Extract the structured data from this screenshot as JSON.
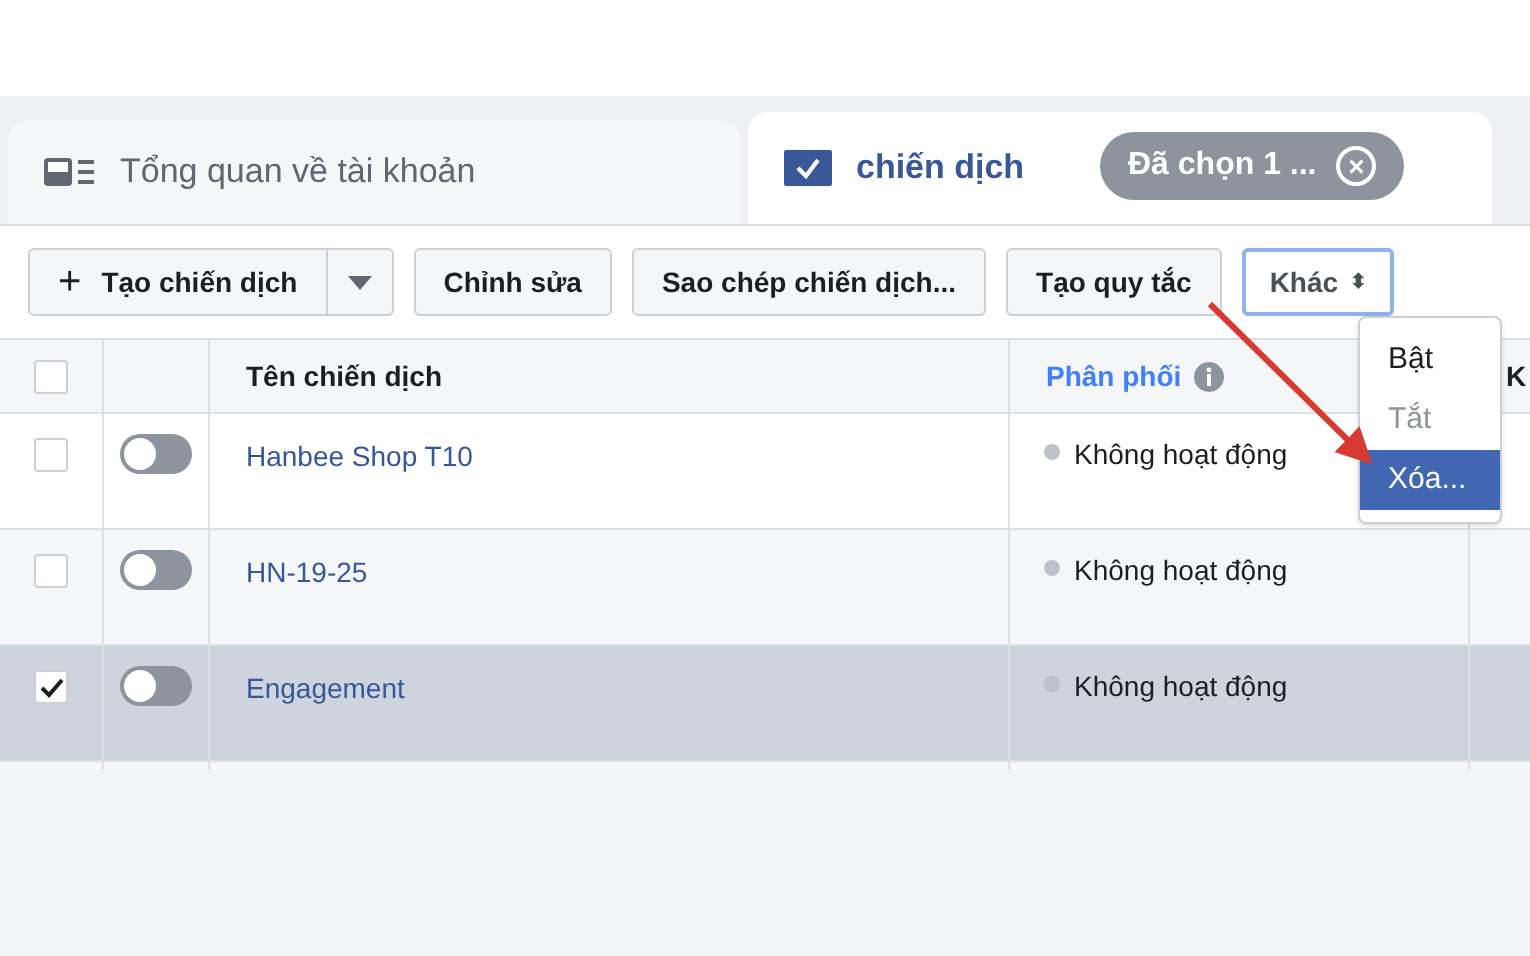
{
  "tabs": [
    {
      "label": "Tổng quan về tài khoản",
      "kind": "overview",
      "selected": false
    },
    {
      "label": "chiến dịch",
      "kind": "campaigns",
      "selected": true
    }
  ],
  "selection_chip": {
    "label": "Đã chọn 1 ...",
    "close": "×"
  },
  "toolbar": {
    "create": {
      "label": "Tạo chiến dịch",
      "icon": "+"
    },
    "buttons": [
      "Chỉnh sửa",
      "Sao chép chiến dịch...",
      "Tạo quy tắc"
    ],
    "more": {
      "label": "Khác",
      "caret": "⬍"
    }
  },
  "menu": [
    {
      "label": "Bật",
      "disabled": false,
      "selected": false
    },
    {
      "label": "Tắt",
      "disabled": true,
      "selected": false
    },
    {
      "label": "Xóa...",
      "disabled": false,
      "selected": true
    }
  ],
  "table": {
    "select_all": {
      "checked": false
    },
    "columns": [
      "Tên chiến dịch",
      "Phân phối",
      "K"
    ],
    "rows": [
      {
        "name": "Hanbee Shop T10",
        "on": false,
        "checked": false,
        "selected": false,
        "delivery": "Không hoạt động"
      },
      {
        "name": "HN-19-25",
        "on": false,
        "checked": false,
        "selected": false,
        "delivery": "Không hoạt động"
      },
      {
        "name": "Engagement",
        "on": false,
        "checked": true,
        "selected": true,
        "delivery": "Không hoạt động"
      }
    ]
  }
}
